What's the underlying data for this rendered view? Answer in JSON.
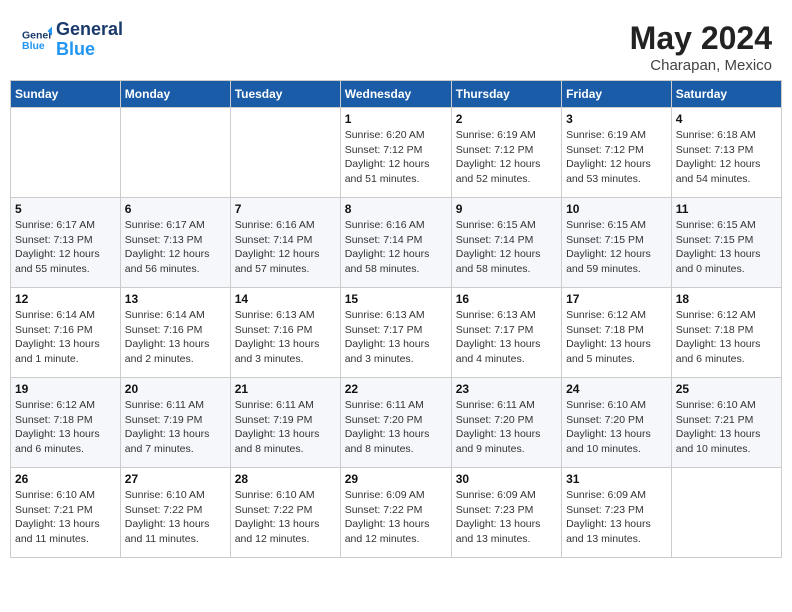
{
  "header": {
    "logo_general": "General",
    "logo_blue": "Blue",
    "month_year": "May 2024",
    "location": "Charapan, Mexico"
  },
  "weekdays": [
    "Sunday",
    "Monday",
    "Tuesday",
    "Wednesday",
    "Thursday",
    "Friday",
    "Saturday"
  ],
  "weeks": [
    [
      {
        "day": "",
        "sunrise": "",
        "sunset": "",
        "daylight": ""
      },
      {
        "day": "",
        "sunrise": "",
        "sunset": "",
        "daylight": ""
      },
      {
        "day": "",
        "sunrise": "",
        "sunset": "",
        "daylight": ""
      },
      {
        "day": "1",
        "sunrise": "Sunrise: 6:20 AM",
        "sunset": "Sunset: 7:12 PM",
        "daylight": "Daylight: 12 hours and 51 minutes."
      },
      {
        "day": "2",
        "sunrise": "Sunrise: 6:19 AM",
        "sunset": "Sunset: 7:12 PM",
        "daylight": "Daylight: 12 hours and 52 minutes."
      },
      {
        "day": "3",
        "sunrise": "Sunrise: 6:19 AM",
        "sunset": "Sunset: 7:12 PM",
        "daylight": "Daylight: 12 hours and 53 minutes."
      },
      {
        "day": "4",
        "sunrise": "Sunrise: 6:18 AM",
        "sunset": "Sunset: 7:13 PM",
        "daylight": "Daylight: 12 hours and 54 minutes."
      }
    ],
    [
      {
        "day": "5",
        "sunrise": "Sunrise: 6:17 AM",
        "sunset": "Sunset: 7:13 PM",
        "daylight": "Daylight: 12 hours and 55 minutes."
      },
      {
        "day": "6",
        "sunrise": "Sunrise: 6:17 AM",
        "sunset": "Sunset: 7:13 PM",
        "daylight": "Daylight: 12 hours and 56 minutes."
      },
      {
        "day": "7",
        "sunrise": "Sunrise: 6:16 AM",
        "sunset": "Sunset: 7:14 PM",
        "daylight": "Daylight: 12 hours and 57 minutes."
      },
      {
        "day": "8",
        "sunrise": "Sunrise: 6:16 AM",
        "sunset": "Sunset: 7:14 PM",
        "daylight": "Daylight: 12 hours and 58 minutes."
      },
      {
        "day": "9",
        "sunrise": "Sunrise: 6:15 AM",
        "sunset": "Sunset: 7:14 PM",
        "daylight": "Daylight: 12 hours and 58 minutes."
      },
      {
        "day": "10",
        "sunrise": "Sunrise: 6:15 AM",
        "sunset": "Sunset: 7:15 PM",
        "daylight": "Daylight: 12 hours and 59 minutes."
      },
      {
        "day": "11",
        "sunrise": "Sunrise: 6:15 AM",
        "sunset": "Sunset: 7:15 PM",
        "daylight": "Daylight: 13 hours and 0 minutes."
      }
    ],
    [
      {
        "day": "12",
        "sunrise": "Sunrise: 6:14 AM",
        "sunset": "Sunset: 7:16 PM",
        "daylight": "Daylight: 13 hours and 1 minute."
      },
      {
        "day": "13",
        "sunrise": "Sunrise: 6:14 AM",
        "sunset": "Sunset: 7:16 PM",
        "daylight": "Daylight: 13 hours and 2 minutes."
      },
      {
        "day": "14",
        "sunrise": "Sunrise: 6:13 AM",
        "sunset": "Sunset: 7:16 PM",
        "daylight": "Daylight: 13 hours and 3 minutes."
      },
      {
        "day": "15",
        "sunrise": "Sunrise: 6:13 AM",
        "sunset": "Sunset: 7:17 PM",
        "daylight": "Daylight: 13 hours and 3 minutes."
      },
      {
        "day": "16",
        "sunrise": "Sunrise: 6:13 AM",
        "sunset": "Sunset: 7:17 PM",
        "daylight": "Daylight: 13 hours and 4 minutes."
      },
      {
        "day": "17",
        "sunrise": "Sunrise: 6:12 AM",
        "sunset": "Sunset: 7:18 PM",
        "daylight": "Daylight: 13 hours and 5 minutes."
      },
      {
        "day": "18",
        "sunrise": "Sunrise: 6:12 AM",
        "sunset": "Sunset: 7:18 PM",
        "daylight": "Daylight: 13 hours and 6 minutes."
      }
    ],
    [
      {
        "day": "19",
        "sunrise": "Sunrise: 6:12 AM",
        "sunset": "Sunset: 7:18 PM",
        "daylight": "Daylight: 13 hours and 6 minutes."
      },
      {
        "day": "20",
        "sunrise": "Sunrise: 6:11 AM",
        "sunset": "Sunset: 7:19 PM",
        "daylight": "Daylight: 13 hours and 7 minutes."
      },
      {
        "day": "21",
        "sunrise": "Sunrise: 6:11 AM",
        "sunset": "Sunset: 7:19 PM",
        "daylight": "Daylight: 13 hours and 8 minutes."
      },
      {
        "day": "22",
        "sunrise": "Sunrise: 6:11 AM",
        "sunset": "Sunset: 7:20 PM",
        "daylight": "Daylight: 13 hours and 8 minutes."
      },
      {
        "day": "23",
        "sunrise": "Sunrise: 6:11 AM",
        "sunset": "Sunset: 7:20 PM",
        "daylight": "Daylight: 13 hours and 9 minutes."
      },
      {
        "day": "24",
        "sunrise": "Sunrise: 6:10 AM",
        "sunset": "Sunset: 7:20 PM",
        "daylight": "Daylight: 13 hours and 10 minutes."
      },
      {
        "day": "25",
        "sunrise": "Sunrise: 6:10 AM",
        "sunset": "Sunset: 7:21 PM",
        "daylight": "Daylight: 13 hours and 10 minutes."
      }
    ],
    [
      {
        "day": "26",
        "sunrise": "Sunrise: 6:10 AM",
        "sunset": "Sunset: 7:21 PM",
        "daylight": "Daylight: 13 hours and 11 minutes."
      },
      {
        "day": "27",
        "sunrise": "Sunrise: 6:10 AM",
        "sunset": "Sunset: 7:22 PM",
        "daylight": "Daylight: 13 hours and 11 minutes."
      },
      {
        "day": "28",
        "sunrise": "Sunrise: 6:10 AM",
        "sunset": "Sunset: 7:22 PM",
        "daylight": "Daylight: 13 hours and 12 minutes."
      },
      {
        "day": "29",
        "sunrise": "Sunrise: 6:09 AM",
        "sunset": "Sunset: 7:22 PM",
        "daylight": "Daylight: 13 hours and 12 minutes."
      },
      {
        "day": "30",
        "sunrise": "Sunrise: 6:09 AM",
        "sunset": "Sunset: 7:23 PM",
        "daylight": "Daylight: 13 hours and 13 minutes."
      },
      {
        "day": "31",
        "sunrise": "Sunrise: 6:09 AM",
        "sunset": "Sunset: 7:23 PM",
        "daylight": "Daylight: 13 hours and 13 minutes."
      },
      {
        "day": "",
        "sunrise": "",
        "sunset": "",
        "daylight": ""
      }
    ]
  ]
}
